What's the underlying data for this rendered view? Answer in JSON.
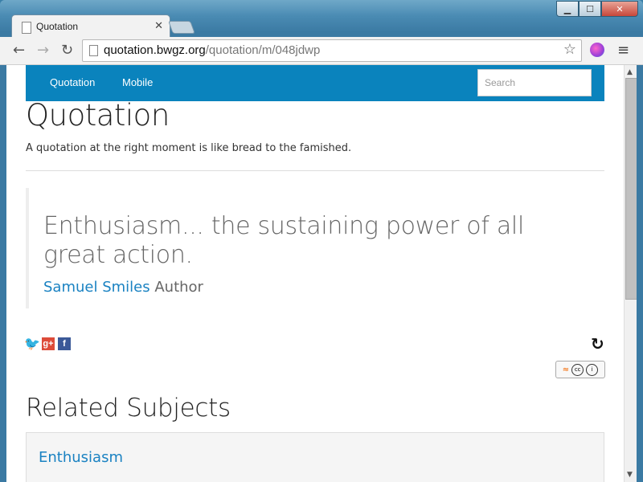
{
  "browser": {
    "tab_title": "Quotation",
    "url_host": "quotation.bwgz.org",
    "url_path": "/quotation/m/048jdwp"
  },
  "navbar": {
    "links": [
      "Quotation",
      "Mobile"
    ],
    "search_placeholder": "Search"
  },
  "page": {
    "heading": "Quotation",
    "tagline": "A quotation at the right moment is like bread to the famished."
  },
  "quote": {
    "text": "Enthusiasm... the sustaining power of all great action.",
    "author_name": "Samuel Smiles",
    "author_role": "Author"
  },
  "share": {
    "icons": [
      "twitter-icon",
      "google-plus-icon",
      "facebook-icon"
    ]
  },
  "related": {
    "title": "Related Subjects",
    "items": [
      "Enthusiasm"
    ]
  },
  "colors": {
    "navbar": "#0a83bd",
    "link": "#1a82c2"
  }
}
